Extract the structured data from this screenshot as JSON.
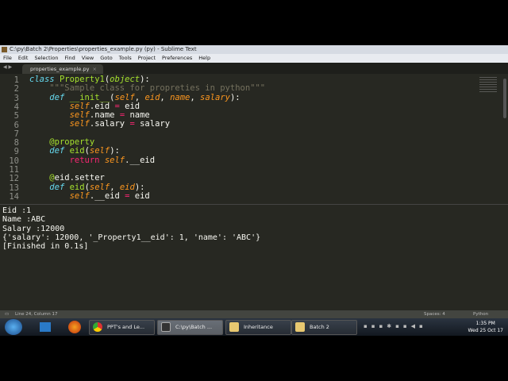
{
  "window": {
    "title": "C:\\py\\Batch 2\\Properties\\properties_example.py (py) - Sublime Text"
  },
  "menu": [
    "File",
    "Edit",
    "Selection",
    "Find",
    "View",
    "Goto",
    "Tools",
    "Project",
    "Preferences",
    "Help"
  ],
  "tab": {
    "label": "properties_example.py",
    "close": "×"
  },
  "code_lines": [
    "1",
    "2",
    "3",
    "4",
    "5",
    "6",
    "7",
    "8",
    "9",
    "10",
    "11",
    "12",
    "13",
    "14"
  ],
  "output": {
    "lines": [
      "Eid :1",
      "Name :ABC",
      "Salary :12000",
      "{'salary': 12000, '_Property1__eid': 1, 'name': 'ABC'}",
      "[Finished in 0.1s]"
    ]
  },
  "status": {
    "position": "Line 24, Column 17",
    "indent": "Spaces: 4",
    "syntax": "Python"
  },
  "taskbar": {
    "items": [
      "PPT's and Le...",
      "C:\\py\\Batch ...",
      "Inheritance",
      "Batch 2"
    ],
    "time": "1:35 PM",
    "date": "Wed 25 Oct 17"
  }
}
